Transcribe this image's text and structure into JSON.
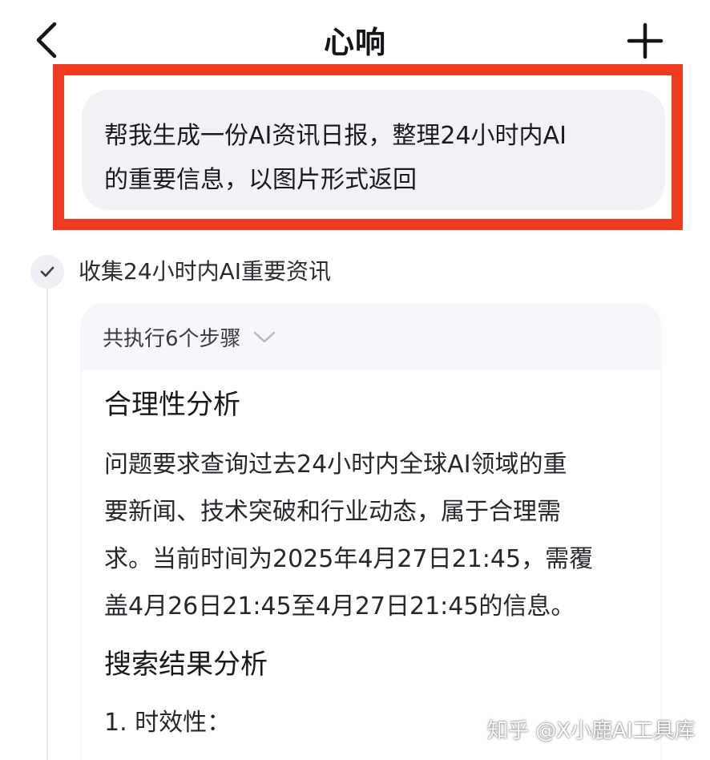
{
  "header": {
    "title": "心响",
    "back_icon": "chevron-left-icon",
    "new_icon": "plus-icon"
  },
  "query": {
    "line1": "帮我生成一份AI资讯日报，整理24小时内AI",
    "line2": "的重要信息，以图片形式返回"
  },
  "colors": {
    "highlight_border": "#ef3b1f",
    "bubble_bg": "#f1f2f6",
    "card_bg": "#f6f7fa"
  },
  "step": {
    "status_icon": "check-icon",
    "title": "收集24小时内AI重要资讯",
    "steps_label": "共执行6个步骤"
  },
  "content": {
    "heading1": "合理性分析",
    "paragraph_lines": [
      "问题要求查询过去24小时内全球AI领域的重",
      "要新闻、技术突破和行业动态，属于合理需",
      "求。当前时间为2025年4月27日21:45，需覆",
      "盖4月26日21:45至4月27日21:45的信息。"
    ],
    "heading2": "搜索结果分析",
    "list_item1": "1. 时效性："
  },
  "watermark": "知乎 @X小鹿AI工具库"
}
